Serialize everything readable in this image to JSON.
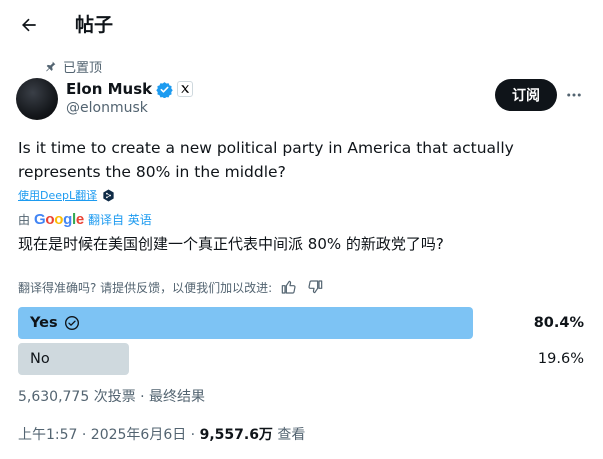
{
  "header": {
    "title": "帖子"
  },
  "pinned_label": "已置顶",
  "author": {
    "name": "Elon Musk",
    "handle": "@elonmusk"
  },
  "subscribe_label": "订阅",
  "tweet": {
    "text": "Is it time to create a new political party in America that actually represents the 80% in the middle?",
    "deepl_label": "使用DeepL翻译",
    "translation_by_prefix": "由",
    "translation_provider": "Google",
    "translate_from_label": "翻译自 英语",
    "translated_text": "现在是时候在美国创建一个真正代表中间派 80% 的新政党了吗?",
    "feedback_question": "翻译得准确吗? 请提供反馈，以便我们加以改进:"
  },
  "poll": {
    "options": [
      {
        "label": "Yes",
        "percent_label": "80.4%",
        "fraction": 0.804,
        "winner": true
      },
      {
        "label": "No",
        "percent_label": "19.6%",
        "fraction": 0.196,
        "winner": false
      }
    ],
    "votes_summary": "5,630,775 次投票 · 最终结果"
  },
  "meta": {
    "timestamp": "上午1:57 · 2025年6月6日 · ",
    "views_count": "9,557.6万",
    "views_label": " 查看"
  },
  "colors": {
    "winner_fill": "#7dc3f4",
    "loser_fill": "#cfd9de",
    "accent": "#1d9bf0",
    "verified": "#1d9bf0"
  }
}
